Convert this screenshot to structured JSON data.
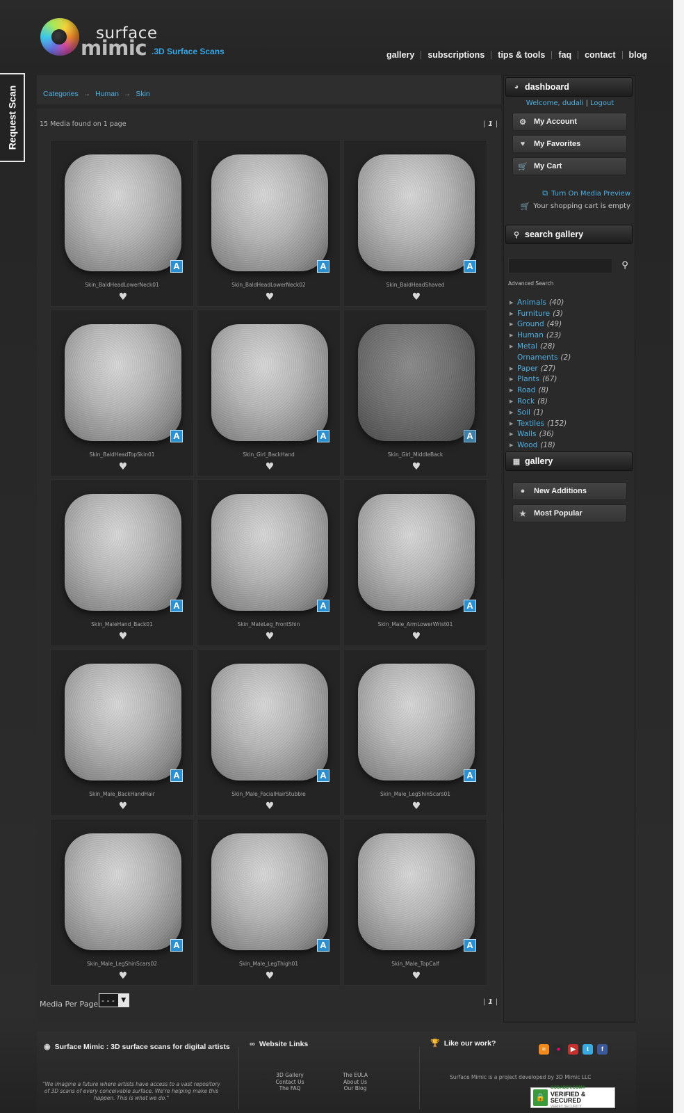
{
  "header": {
    "logo_surface": "surface",
    "logo_mimic": "mimic",
    "logo_tagline": ".3D Surface Scans",
    "nav": [
      "gallery",
      "subscriptions",
      "tips & tools",
      "faq",
      "contact",
      "blog"
    ]
  },
  "request_scan": "Request Scan",
  "breadcrumb": {
    "categories": "Categories",
    "human": "Human",
    "skin": "Skin"
  },
  "listing": {
    "media_count": "15 Media found on 1 page",
    "current_page": "1",
    "items": [
      {
        "name": "Skin_BaldHeadLowerNeck01"
      },
      {
        "name": "Skin_BaldHeadLowerNeck02"
      },
      {
        "name": "Skin_BaldHeadShaved"
      },
      {
        "name": "Skin_BaldHeadTopSkin01"
      },
      {
        "name": "Skin_Girl_BackHand"
      },
      {
        "name": "Skin_Girl_MiddleBack"
      },
      {
        "name": "Skin_MaleHand_Back01"
      },
      {
        "name": "Skin_MaleLeg_FrontShin"
      },
      {
        "name": "Skin_Male_ArmLowerWrist01"
      },
      {
        "name": "Skin_Male_BackHandHair"
      },
      {
        "name": "Skin_Male_FacialHairStubble"
      },
      {
        "name": "Skin_Male_LegShinScars01"
      },
      {
        "name": "Skin_Male_LegShinScars02"
      },
      {
        "name": "Skin_Male_LegThigh01"
      },
      {
        "name": "Skin_Male_TopCalf"
      }
    ],
    "badge_letter": "A",
    "per_page_label": "Media Per Page",
    "per_page_value": "- - -"
  },
  "sidebar": {
    "dashboard_title": "dashboard",
    "welcome_prefix": "Welcome, dudali",
    "logout": "Logout",
    "my_account": "My Account",
    "my_favorites": "My Favorites",
    "my_cart": "My Cart",
    "media_preview": "Turn On Media Preview",
    "cart_status": "Your shopping cart is empty",
    "search_title": "search gallery",
    "advanced_search": "Advanced Search",
    "categories": [
      {
        "name": "Animals",
        "count": "(40)",
        "expandable": true
      },
      {
        "name": "Furniture",
        "count": "(3)",
        "expandable": true
      },
      {
        "name": "Ground",
        "count": "(49)",
        "expandable": true
      },
      {
        "name": "Human",
        "count": "(23)",
        "expandable": true
      },
      {
        "name": "Metal",
        "count": "(28)",
        "expandable": true
      },
      {
        "name": "Ornaments",
        "count": "(2)",
        "expandable": false
      },
      {
        "name": "Paper",
        "count": "(27)",
        "expandable": true
      },
      {
        "name": "Plants",
        "count": "(67)",
        "expandable": true
      },
      {
        "name": "Road",
        "count": "(8)",
        "expandable": true
      },
      {
        "name": "Rock",
        "count": "(8)",
        "expandable": true
      },
      {
        "name": "Soil",
        "count": "(1)",
        "expandable": true
      },
      {
        "name": "Textiles",
        "count": "(152)",
        "expandable": true
      },
      {
        "name": "Walls",
        "count": "(36)",
        "expandable": true
      },
      {
        "name": "Wood",
        "count": "(18)",
        "expandable": true
      }
    ],
    "gallery_title": "gallery",
    "new_additions": "New Additions",
    "most_popular": "Most Popular"
  },
  "footer": {
    "brand_title": "Surface Mimic : 3D surface scans for digital artists",
    "quote_line1": "\"We imagine a future where artists have access to a vast repository",
    "quote_line2": "of 3D scans of every conceivable surface. We're helping make this",
    "quote_line3": "happen. This is what we do.\"",
    "links_title": "Website Links",
    "links_col1": [
      "3D Gallery",
      "Contact Us",
      "The FAQ"
    ],
    "links_col2": [
      "The EULA",
      "About Us",
      "Our Blog"
    ],
    "like_title": "Like our work?",
    "developer_note": "Surface Mimic is a project developed by 3D Mimic LLC",
    "seal_line1": "GODADDY.COM®",
    "seal_line2": "VERIFIED & SECURED",
    "seal_line3": "VERIFY SECURITY"
  },
  "icons": {
    "social": [
      "rss-icon",
      "flickr-icon",
      "youtube-icon",
      "twitter-icon",
      "facebook-icon"
    ]
  },
  "colors": {
    "accent_link": "#4fb0e3",
    "badge_blue": "#2b8fd0",
    "background": "#2b2b2b"
  }
}
